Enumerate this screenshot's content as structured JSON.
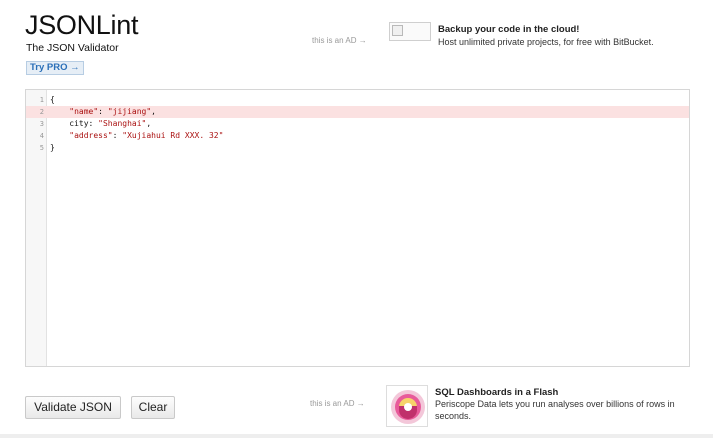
{
  "header": {
    "logo": "JSONLint",
    "tagline": "The JSON Validator",
    "try_pro": "Try PRO →"
  },
  "ad_top": {
    "label": "this is an AD →",
    "title": "Backup your code in the cloud!",
    "text": "Host unlimited private projects, for free with BitBucket."
  },
  "editor": {
    "lines": [
      {
        "num": "1",
        "text": "{"
      },
      {
        "num": "2",
        "text": "    \"name\": \"jijiang\",",
        "error": true
      },
      {
        "num": "3",
        "text": "    city: \"Shanghai\","
      },
      {
        "num": "4",
        "text": "    \"address\": \"Xujiahui Rd XXX. 32\""
      },
      {
        "num": "5",
        "text": "}"
      }
    ]
  },
  "buttons": {
    "validate": "Validate JSON",
    "clear": "Clear"
  },
  "ad_bottom": {
    "label": "this is an AD →",
    "title": "SQL Dashboards in a Flash",
    "text": "Periscope Data lets you run analyses over billions of rows in seconds."
  },
  "colors": {
    "error_line": "#fbe1e1",
    "string": "#aa1111",
    "pro_link": "#2a6fb8"
  }
}
